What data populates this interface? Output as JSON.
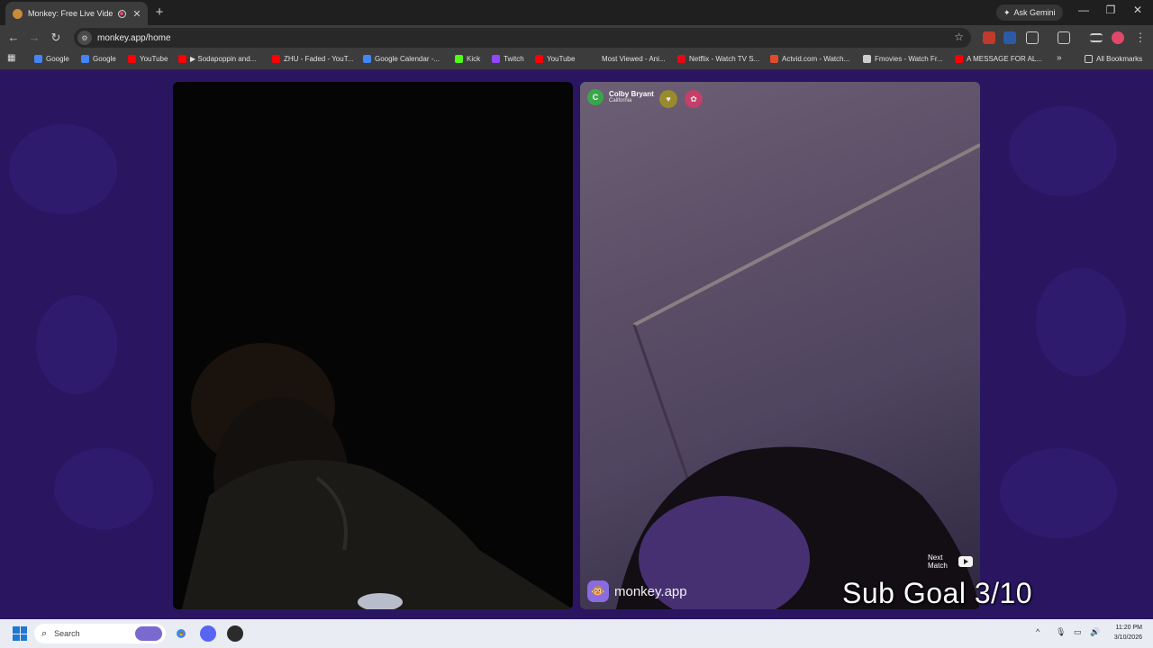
{
  "browser": {
    "tab_title": "Monkey: Free Live Video Ch",
    "new_tab": "+",
    "ask_gemini": "Ask Gemini",
    "url": "monkey.app/home",
    "bookmarks": [
      {
        "label": "Google",
        "color": "#4285f4"
      },
      {
        "label": "Google",
        "color": "#4285f4"
      },
      {
        "label": "YouTube",
        "color": "#ff0000"
      },
      {
        "label": "▶ Sodapoppin and...",
        "color": "#ff0000"
      },
      {
        "label": "ZHU - Faded - YouT...",
        "color": "#ff0000"
      },
      {
        "label": "Google Calendar -...",
        "color": "#4285f4"
      },
      {
        "label": "Kick",
        "color": "#53fc18"
      },
      {
        "label": "Twitch",
        "color": "#9146ff"
      },
      {
        "label": "YouTube",
        "color": "#ff0000"
      },
      {
        "label": "Most Viewed - Ani...",
        "color": "#3c3c3c"
      },
      {
        "label": "Netflix - Watch TV S...",
        "color": "#e50914"
      },
      {
        "label": "Actvid.com - Watch...",
        "color": "#e04b2a"
      },
      {
        "label": "Fmovies - Watch Fr...",
        "color": "#cccccc"
      },
      {
        "label": "A MESSAGE FOR AL...",
        "color": "#ff0000"
      }
    ],
    "more_bookmarks": "»",
    "all_bookmarks": "All Bookmarks"
  },
  "chat": {
    "peer": {
      "initial": "C",
      "name": "Colby Bryant",
      "location": "California"
    },
    "badge_icons": [
      "heart-badge-icon",
      "gift-badge-icon"
    ],
    "brand_name": "monkey.app",
    "next_match": "Next Match",
    "overlay": "Sub Goal 3/10"
  },
  "taskbar": {
    "search_placeholder": "Search",
    "time": "11:20 PM",
    "date": "3/10/2026"
  },
  "colors": {
    "page_bg": "#2a1660",
    "accent": "#8a6be0",
    "peer_avatar": "#3aa64a"
  }
}
